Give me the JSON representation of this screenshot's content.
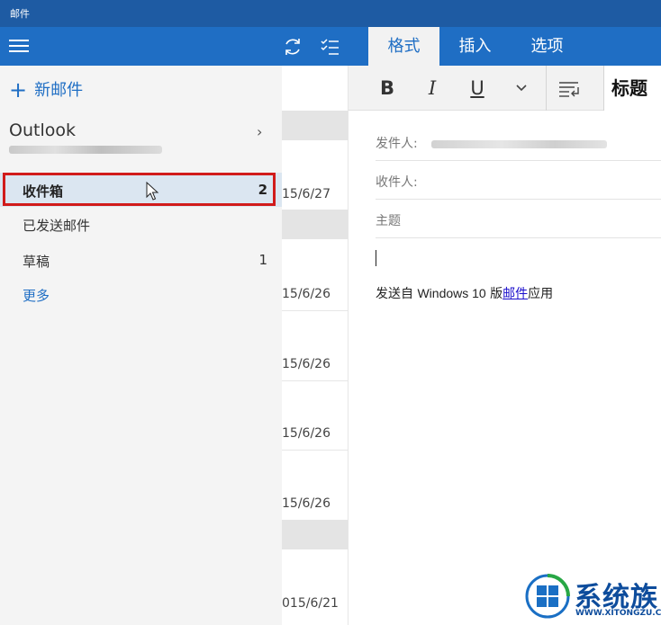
{
  "window": {
    "title": "邮件"
  },
  "ribbon": {
    "tabs": [
      {
        "label": "格式",
        "active": true
      },
      {
        "label": "插入",
        "active": false
      },
      {
        "label": "选项",
        "active": false
      }
    ],
    "format": {
      "bold": "B",
      "italic": "I",
      "underline": "U",
      "heading_style": "标题"
    }
  },
  "sidebar": {
    "new_mail_label": "新邮件",
    "account": {
      "name": "Outlook"
    },
    "folders": [
      {
        "label": "收件箱",
        "count": "2",
        "selected": true
      },
      {
        "label": "已发送邮件",
        "count": ""
      },
      {
        "label": "草稿",
        "count": "1"
      }
    ],
    "more_label": "更多"
  },
  "message_list": {
    "dates": [
      "15/6/27",
      "15/6/26",
      "15/6/26",
      "15/6/26",
      "15/6/26",
      "015/6/21"
    ]
  },
  "compose": {
    "from_label": "发件人:",
    "to_label": "收件人:",
    "subject_placeholder": "主题",
    "signature": {
      "prefix": "发送自",
      "app": "Windows 10",
      "version_char": "版",
      "link_text": "邮件",
      "suffix": "应用"
    }
  },
  "watermark": {
    "brand": "系统族",
    "url": "WWW.XITONGZU.COM"
  },
  "colors": {
    "titlebar": "#1e5ba3",
    "accent": "#1f6ec4",
    "selection_outline": "#d11b1b",
    "selected_bg": "#dbe6f1"
  },
  "icons": [
    "hamburger-icon",
    "sync-icon",
    "select-mode-icon",
    "plus-icon",
    "chevron-right-icon",
    "chevron-down-icon",
    "paragraph-icon",
    "mouse-pointer-icon",
    "windows-logo-icon"
  ]
}
